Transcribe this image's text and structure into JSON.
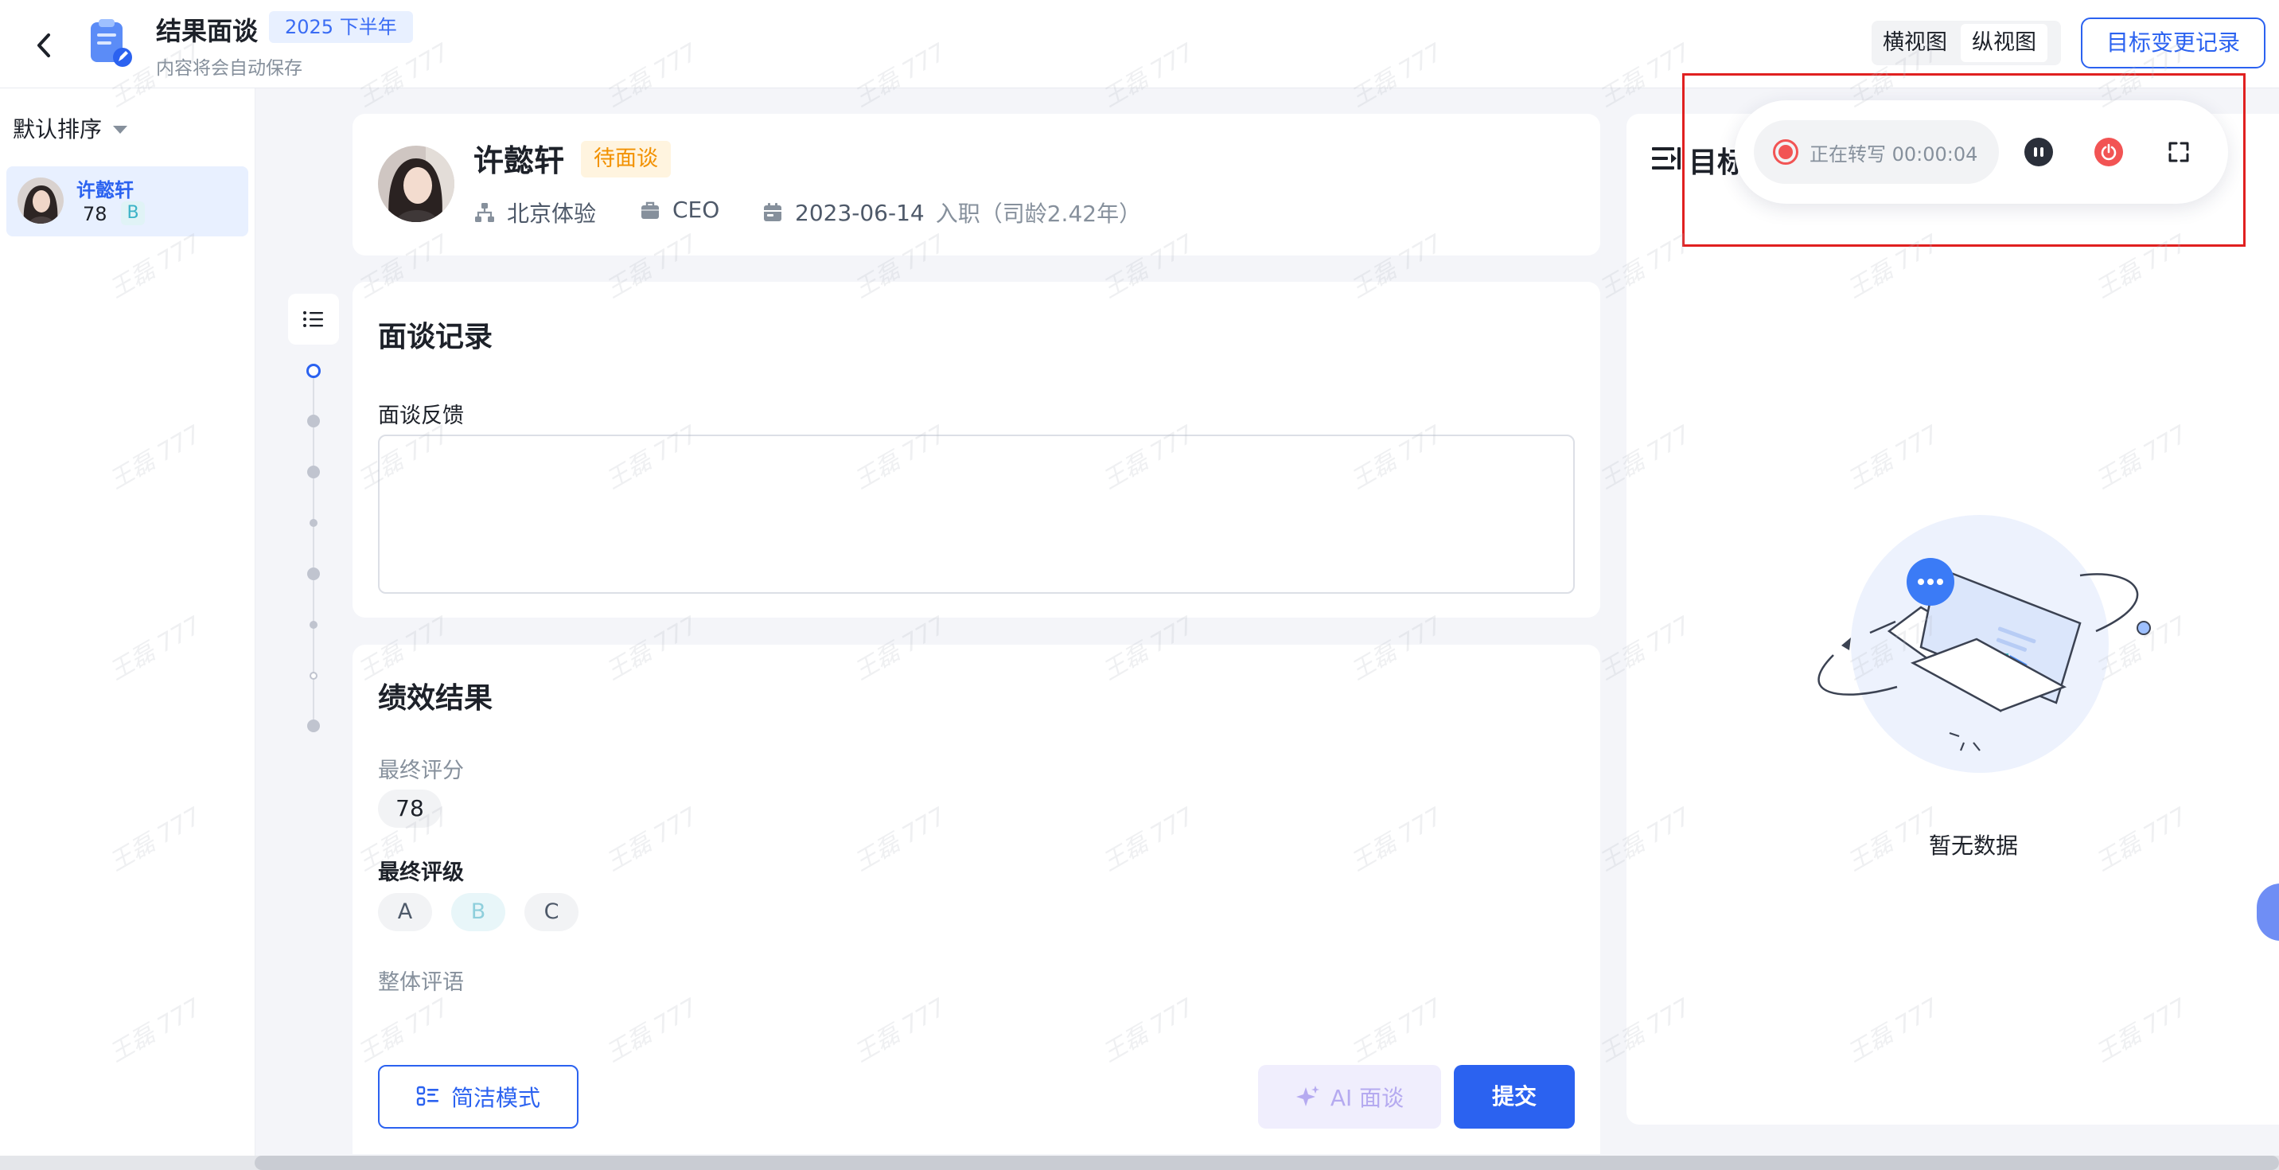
{
  "header": {
    "title": "结果面谈",
    "period": "2025 下半年",
    "autosave": "内容将会自动保存",
    "views": {
      "horizontal": "横视图",
      "vertical": "纵视图",
      "active": "vertical"
    },
    "change_log": "目标变更记录"
  },
  "sidebar": {
    "sort_label": "默认排序",
    "employees": [
      {
        "name": "许懿轩",
        "score": "78",
        "grade": "B"
      }
    ]
  },
  "profile": {
    "name": "许懿轩",
    "status": "待面谈",
    "department": "北京体验",
    "role": "CEO",
    "join_date": "2023-06-14",
    "join_suffix": "入职（司龄2.42年）"
  },
  "record": {
    "title": "面谈记录",
    "feedback_label": "面谈反馈",
    "feedback_value": ""
  },
  "performance": {
    "title": "绩效结果",
    "final_score_label": "最终评分",
    "final_score": "78",
    "final_grade_label": "最终评级",
    "grades": [
      "A",
      "B",
      "C"
    ],
    "selected_grade": "B",
    "overall_label": "整体评语"
  },
  "actions": {
    "simple_mode": "简洁模式",
    "ai_interview": "AI 面谈",
    "submit": "提交"
  },
  "right_panel": {
    "title": "目标",
    "empty_text": "暂无数据"
  },
  "recorder": {
    "status": "正在转写 00:00:04"
  },
  "watermark": "王磊 777",
  "colors": {
    "primary": "#2b62f0",
    "status_pending": "#f29100",
    "record_red": "#f25454",
    "annotation": "#e02020"
  }
}
